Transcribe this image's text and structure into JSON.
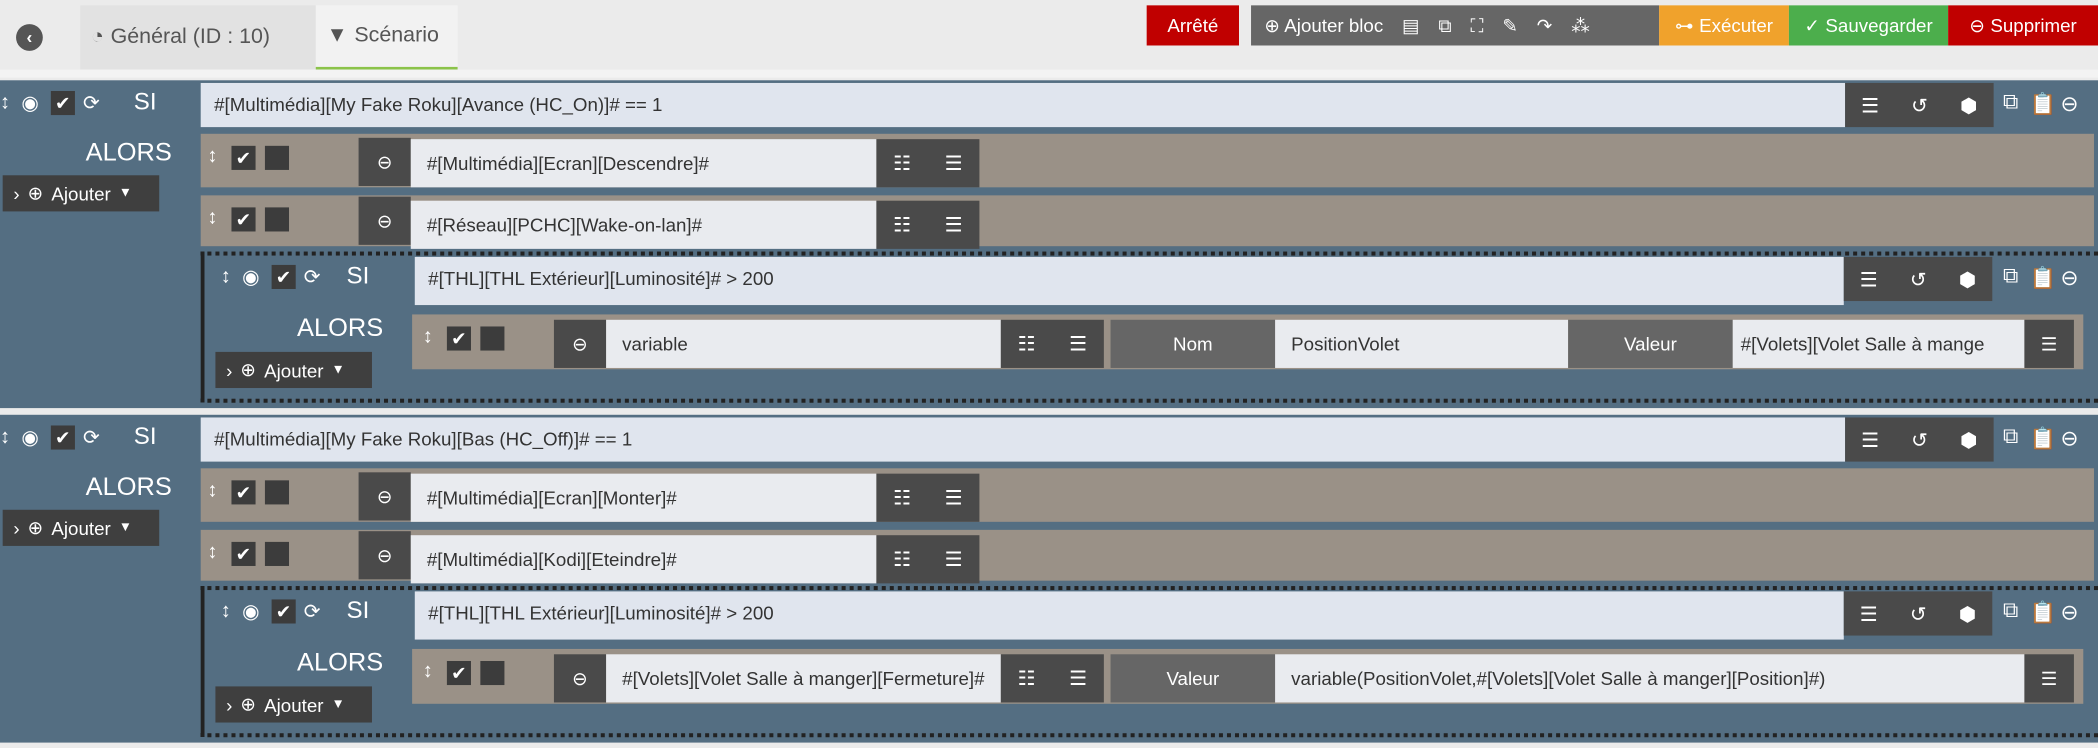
{
  "topbar": {
    "tabs": [
      {
        "label": "Général (ID : 10)",
        "icon": "dashboard-icon"
      },
      {
        "label": "Scénario",
        "icon": "filter-icon"
      }
    ],
    "status": "Arrêté",
    "add_block": "Ajouter bloc",
    "execute": "Exécuter",
    "save": "Sauvegarder",
    "delete": "Supprimer"
  },
  "colors": {
    "status": "#c00000",
    "toolbar": "#666666",
    "execute": "#f0a22c",
    "save": "#4cae4c",
    "delete": "#c00000",
    "block": "#546e82",
    "action": "#9a9187"
  },
  "labels": {
    "si": "SI",
    "alors": "ALORS",
    "ajouter": "Ajouter",
    "nom": "Nom",
    "valeur": "Valeur"
  },
  "blocks": [
    {
      "condition": "#[Multimédia][My Fake Roku][Avance (HC_On)]# == 1",
      "actions": [
        "#[Multimédia][Ecran][Descendre]#",
        "#[Réseau][PCHC][Wake-on-lan]#"
      ],
      "nested": {
        "condition": "#[THL][THL Extérieur][Luminosité]# > 200",
        "action": {
          "cmd": "variable",
          "fields": [
            {
              "label": "Nom",
              "value": "PositionVolet"
            },
            {
              "label": "Valeur",
              "value": "#[Volets][Volet Salle à mange"
            }
          ]
        }
      }
    },
    {
      "condition": "#[Multimédia][My Fake Roku][Bas (HC_Off)]# == 1",
      "actions": [
        "#[Multimédia][Ecran][Monter]#",
        "#[Multimédia][Kodi][Eteindre]#"
      ],
      "nested": {
        "condition": "#[THL][THL Extérieur][Luminosité]# > 200",
        "action": {
          "cmd": "#[Volets][Volet Salle à manger][Fermeture]#",
          "fields": [
            {
              "label": "Valeur",
              "value": "variable(PositionVolet,#[Volets][Volet Salle à manger][Position]#)"
            }
          ]
        }
      }
    }
  ]
}
